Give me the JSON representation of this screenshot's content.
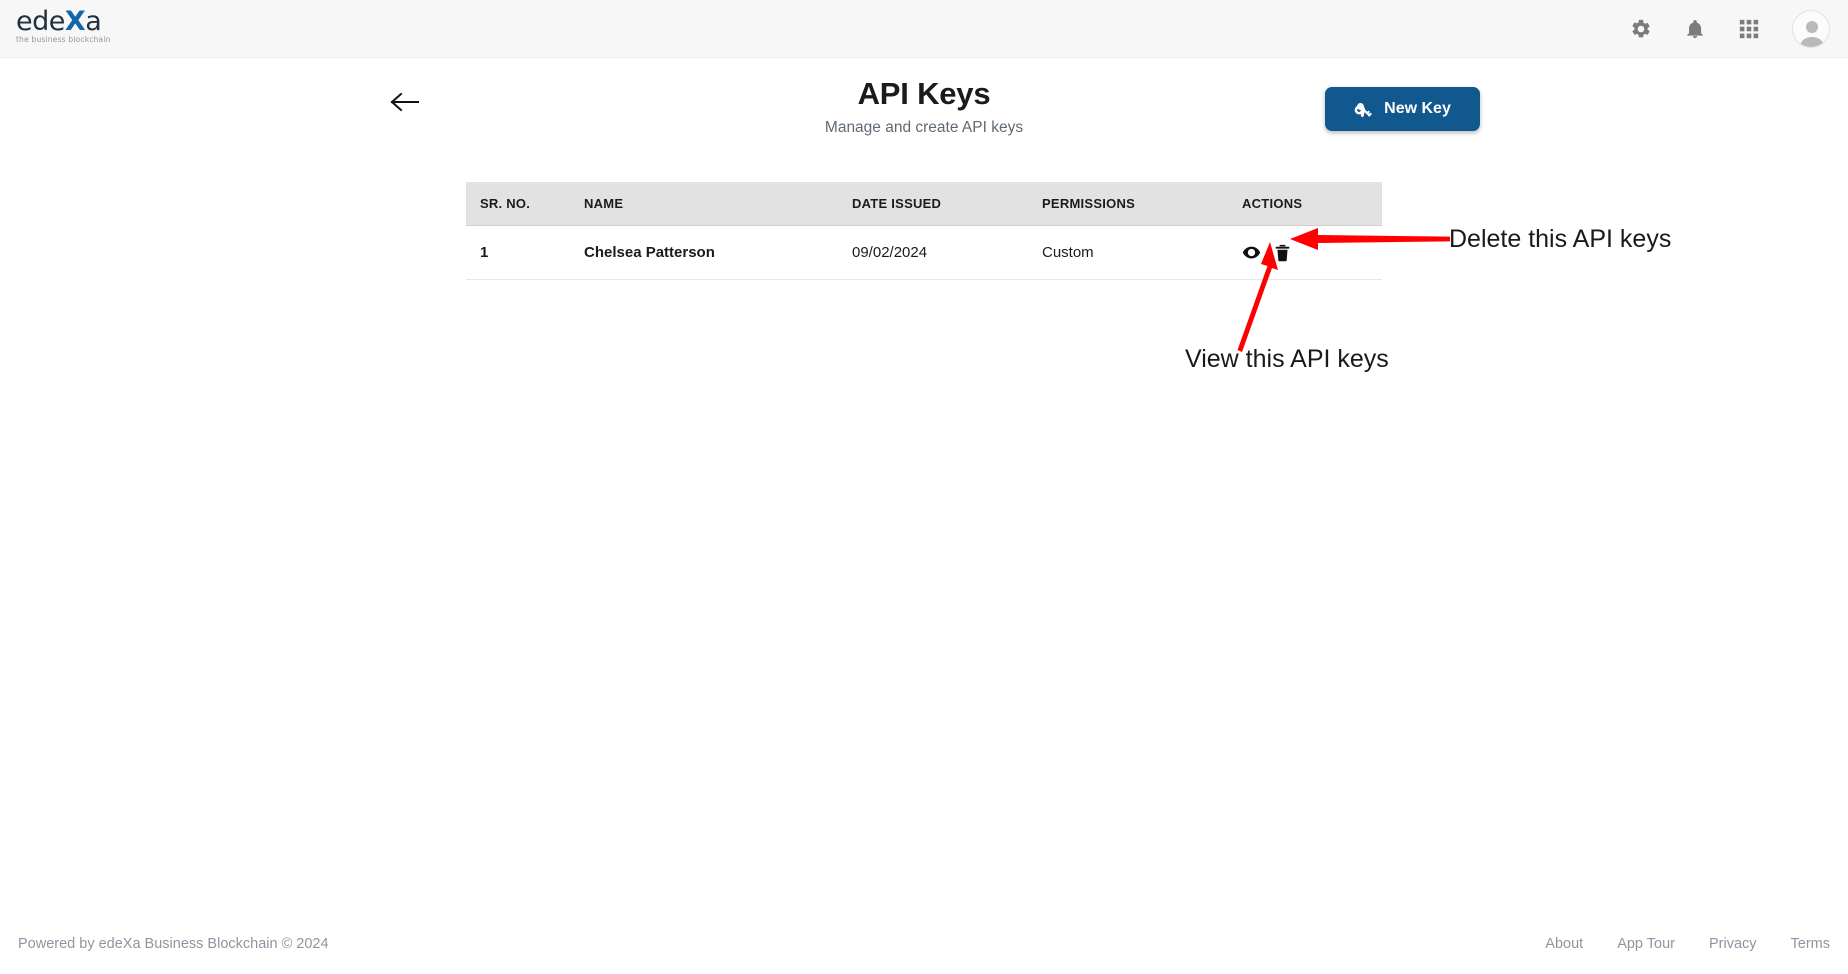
{
  "topbar": {
    "logo": {
      "text_before": "ede",
      "text_x": "X",
      "text_after": "a",
      "tagline": "the business blockchain"
    },
    "icons": [
      {
        "name": "settings-icon",
        "label": "gear-icon"
      },
      {
        "name": "notifications-icon",
        "label": "bell-icon"
      },
      {
        "name": "apps-grid-icon",
        "label": "grid-icon"
      }
    ],
    "avatar_label": "user-avatar"
  },
  "header": {
    "back_label": "back-arrow",
    "title": "API Keys",
    "subtitle": "Manage and create API keys",
    "new_key_button": "New Key",
    "accent_color": "#11588f"
  },
  "table": {
    "columns": [
      "SR. NO.",
      "NAME",
      "DATE ISSUED",
      "PERMISSIONS",
      "ACTIONS"
    ],
    "rows": [
      {
        "sr_no": "1",
        "name": "Chelsea Patterson",
        "date_issued": "09/02/2024",
        "permissions": "Custom",
        "actions": [
          "view",
          "delete"
        ]
      }
    ]
  },
  "annotations": {
    "color": "#ff0000",
    "delete_note": "Delete this API keys",
    "view_note": "View this API keys"
  },
  "footer": {
    "copyright": "Powered by edeXa Business Blockchain © 2024",
    "links": [
      "About",
      "App Tour",
      "Privacy",
      "Terms"
    ]
  }
}
